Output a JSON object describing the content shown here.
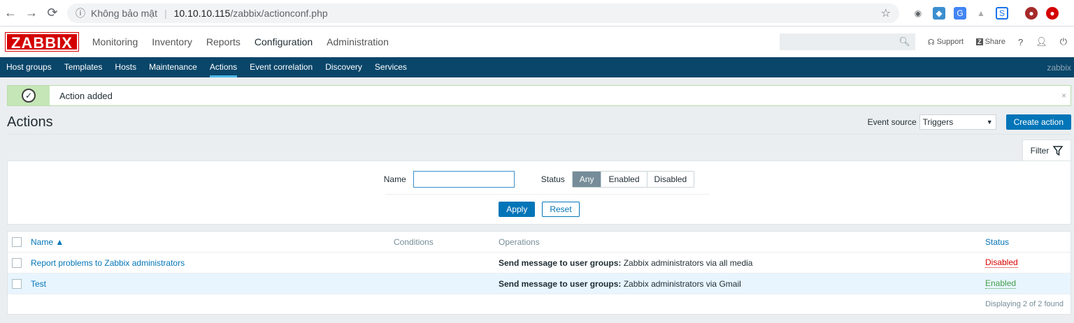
{
  "browser": {
    "security_label": "Không bảo mật",
    "url_host": "10.10.10.115",
    "url_path": "/zabbix/actionconf.php"
  },
  "topbar": {
    "logo": "ZABBIX",
    "menu": [
      "Monitoring",
      "Inventory",
      "Reports",
      "Configuration",
      "Administration"
    ],
    "active_menu": "Configuration",
    "support_label": "Support",
    "share_label": "Share",
    "help_label": "?"
  },
  "submenu": {
    "items": [
      "Host groups",
      "Templates",
      "Hosts",
      "Maintenance",
      "Actions",
      "Event correlation",
      "Discovery",
      "Services"
    ],
    "active": "Actions",
    "user": "zabbix"
  },
  "message": {
    "text": "Action added",
    "close": "×"
  },
  "page": {
    "title": "Actions",
    "event_source_label": "Event source",
    "event_source_value": "Triggers",
    "create_button": "Create action"
  },
  "filter": {
    "tab_label": "Filter",
    "name_label": "Name",
    "name_value": "",
    "status_label": "Status",
    "status_options": [
      "Any",
      "Enabled",
      "Disabled"
    ],
    "status_selected": "Any",
    "apply": "Apply",
    "reset": "Reset"
  },
  "table": {
    "headers": {
      "name": "Name ▲",
      "conditions": "Conditions",
      "operations": "Operations",
      "status": "Status"
    },
    "rows": [
      {
        "name": "Report problems to Zabbix administrators",
        "conditions": "",
        "operation_bold": "Send message to user groups:",
        "operation_rest": " Zabbix administrators via all media",
        "status": "Disabled"
      },
      {
        "name": "Test",
        "conditions": "",
        "operation_bold": "Send message to user groups:",
        "operation_rest": " Zabbix administrators via Gmail",
        "status": "Enabled"
      }
    ],
    "footer": "Displaying 2 of 2 found"
  }
}
